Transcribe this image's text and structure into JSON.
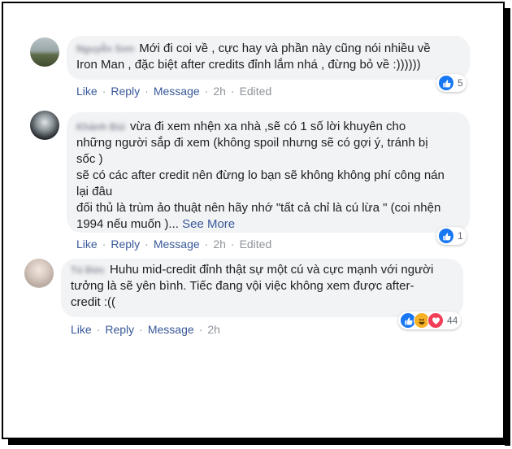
{
  "comments": [
    {
      "name": "Nguyễn Sơn",
      "lines": [
        "Mới đi coi về , cực hay và phần này cũng nói nhiều về",
        "Iron Man , đặc biệt after credits đỉnh lắm nhá , đừng bỏ về :))))))"
      ],
      "actions": {
        "like": "Like",
        "reply": "Reply",
        "message": "Message",
        "time": "2h",
        "edited": "Edited"
      },
      "reaction_count": "5"
    },
    {
      "name": "Khánh Bùi",
      "lines": [
        "vừa đi xem nhện xa nhà ,sẽ có 1 số lời khuyên cho",
        "những người sắp đi xem (không spoil nhưng sẽ có gợi ý, tránh bị",
        "sốc )",
        "sẽ có các after credit nên đừng lo bạn sẽ không không phí công nán",
        "lại đâu",
        "đối thủ là trùm ảo thuật nên hãy nhớ \"tất cả chỉ là cú lừa \" (coi nhện",
        "1994 nếu muốn )..."
      ],
      "see_more": "See More",
      "actions": {
        "like": "Like",
        "reply": "Reply",
        "message": "Message",
        "time": "2h",
        "edited": "Edited"
      },
      "reaction_count": "1"
    },
    {
      "name": "Tú Đức",
      "lines": [
        "Huhu mid-credit đỉnh thật sự một cú và cực mạnh với người",
        "tưởng là sẽ yên bình. Tiếc đang vội việc không xem được after-",
        "credit :(("
      ],
      "actions": {
        "like": "Like",
        "reply": "Reply",
        "message": "Message",
        "time": "2h"
      },
      "reaction_count": "44"
    }
  ],
  "icons": {
    "reactions": [
      "like-icon",
      "haha-icon",
      "love-icon"
    ]
  },
  "colors": {
    "link": "#385898",
    "bubble": "#f2f3f5",
    "like": "#1877f2"
  }
}
